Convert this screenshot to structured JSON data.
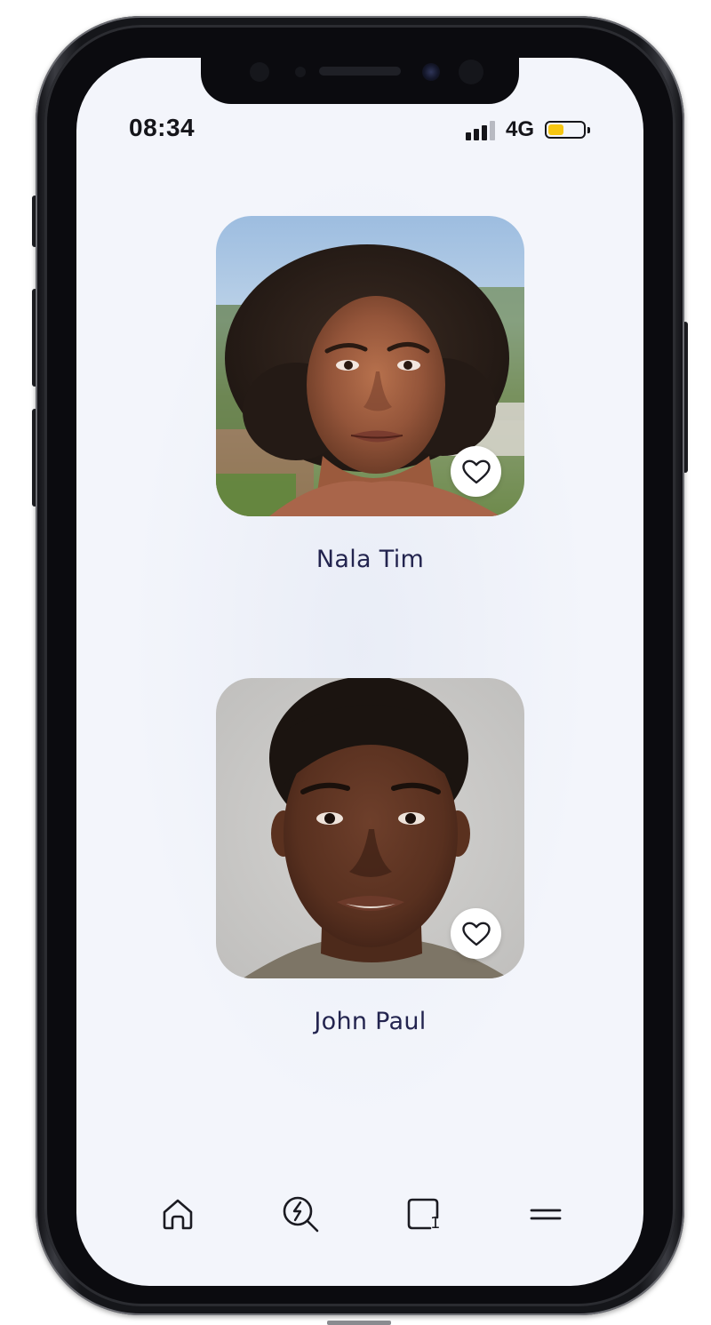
{
  "status_bar": {
    "time": "08:34",
    "network": "4G",
    "battery_level": 0.5,
    "signal_bars_filled": 3,
    "signal_bars_total": 4,
    "battery_color": "#f6c611"
  },
  "profiles": [
    {
      "name": "Nala Tim",
      "liked": false
    },
    {
      "name": "John Paul",
      "liked": false
    }
  ],
  "nav": {
    "items": [
      {
        "icon": "home-icon"
      },
      {
        "icon": "search-lightning-icon"
      },
      {
        "icon": "square-badge-icon",
        "badge": "1"
      },
      {
        "icon": "menu-icon"
      }
    ]
  },
  "colors": {
    "background": "#f3f5fb",
    "name_text": "#23244f",
    "icon": "#1b1b22"
  }
}
